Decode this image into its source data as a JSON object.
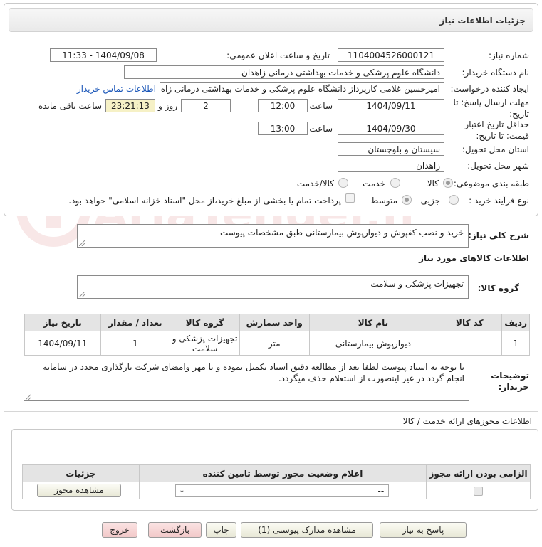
{
  "header": {
    "title": "جزئیات اطلاعات نیاز"
  },
  "form": {
    "need_number_label": "شماره نیاز:",
    "need_number": "1104004526000121",
    "announce_label": "تاریخ و ساعت اعلان عمومی:",
    "announce_value": "1404/09/08 - 11:33",
    "buyer_org_label": "نام دستگاه خریدار:",
    "buyer_org": "دانشگاه علوم پزشکی و خدمات بهداشتی درمانی زاهدان",
    "creator_label": "ایجاد کننده درخواست:",
    "creator": "امیرحسین غلامی کارپرداز دانشگاه علوم پزشکی و خدمات بهداشتی درمانی زاه",
    "contact_link": "اطلاعات تماس خریدار",
    "deadline_label_1": "مهلت ارسال پاسخ: تا",
    "deadline_label_2": "تاریخ:",
    "deadline_date": "1404/09/11",
    "time_label": "ساعت",
    "deadline_time": "12:00",
    "days_value": "2",
    "days_label": "روز و",
    "remaining_time": "23:21:13",
    "remaining_label": "ساعت باقی مانده",
    "validity_label_1": "حداقل تاریخ اعتبار",
    "validity_label_2": "قیمت: تا تاریخ:",
    "validity_date": "1404/09/30",
    "validity_time": "13:00",
    "province_label": "استان محل تحویل:",
    "province": "سیستان و بلوچستان",
    "city_label": "شهر محل تحویل:",
    "city": "زاهدان",
    "category_label": "طبقه بندی موضوعی:",
    "category_options": [
      "کالا",
      "خدمت",
      "کالا/خدمت"
    ],
    "category_selected": "کالا",
    "process_label": "نوع فرآیند خرید :",
    "process_options": [
      "جزیی",
      "متوسط"
    ],
    "process_selected": "جزیی",
    "payment_note": "پرداخت تمام یا بخشی از مبلغ خرید،از محل \"اسناد خزانه اسلامی\" خواهد بود."
  },
  "description": {
    "label": "شرح کلی نیاز:",
    "value": "خرید و نصب کفپوش و دیوارپوش بیمارستانی طبق مشخصات پیوست"
  },
  "goods": {
    "section_title": "اطلاعات کالاهای مورد نیاز",
    "group_label": "گروه کالا:",
    "group_value": "تجهیزات پزشکی و سلامت",
    "columns": [
      "ردیف",
      "کد کالا",
      "نام کالا",
      "واحد شمارش",
      "گروه کالا",
      "تعداد / مقدار",
      "تاریخ نیاز"
    ],
    "rows": [
      [
        "1",
        "--",
        "دیوارپوش بیمارستانی",
        "متر",
        "تجهیزات پزشکی و سلامت",
        "1",
        "1404/09/11"
      ]
    ]
  },
  "buyer_notes": {
    "label_1": "توضیحات",
    "label_2": "خریدار:",
    "value": "با توجه به اسناد پیوست لطفا بعد از مطالعه دقیق اسناد تکمیل نموده و با مهر وامضای شرکت بارگذاری مجدد در سامانه انجام گردد در غیر اینصورت از استعلام حذف میگردد."
  },
  "permits": {
    "title": "اطلاعات مجوزهای ارائه خدمت / کالا",
    "columns": [
      "الزامی بودن ارائه مجوز",
      "اعلام وضعیت مجوز توسط تامین کننده",
      "جزئیات"
    ],
    "select_value": "--",
    "view_button": "مشاهده مجوز"
  },
  "footer": {
    "reply": "پاسخ به نیاز",
    "attachments": "مشاهده مدارک پیوستی (1)",
    "print": "چاپ",
    "back": "بازگشت",
    "exit": "خروج"
  },
  "watermark": "AriaTender.neT"
}
